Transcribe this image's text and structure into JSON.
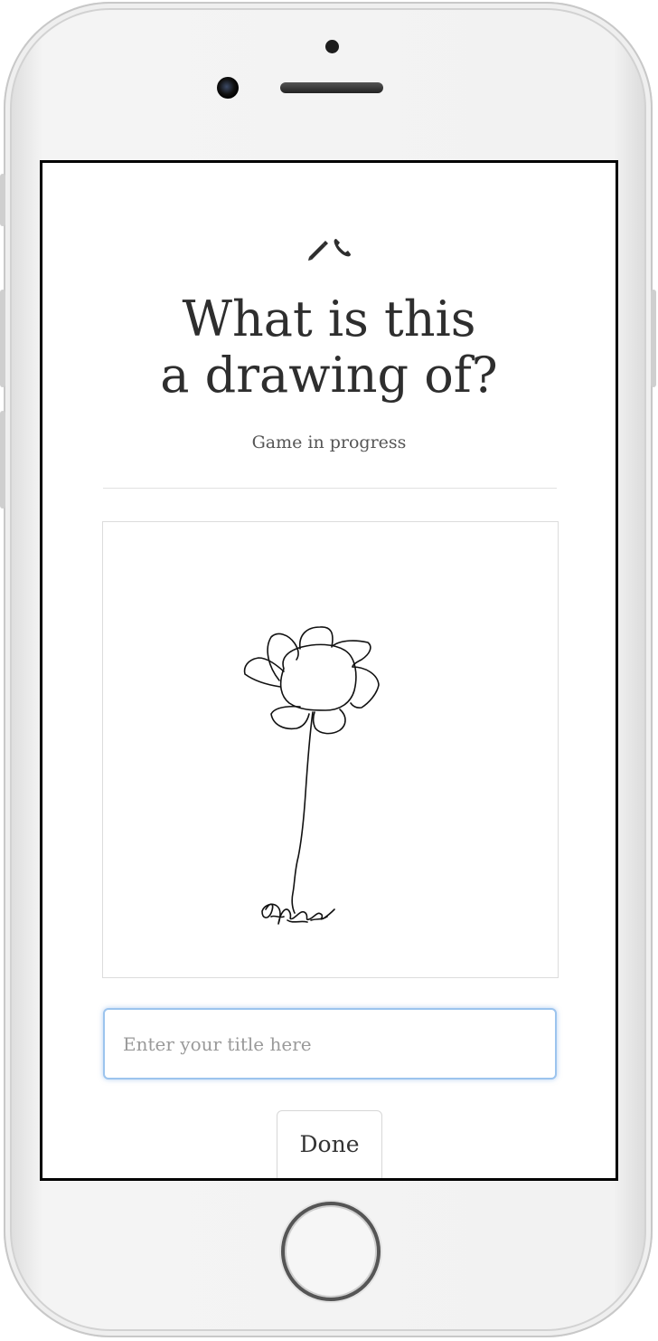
{
  "prompt": {
    "heading": "What is this a drawing of?",
    "status": "Game in progress"
  },
  "guess_input": {
    "value": "",
    "placeholder": "Enter your title here"
  },
  "actions": {
    "done_label": "Done"
  },
  "icons": {
    "app_logo": "pencil-and-phone-icon"
  },
  "drawing": {
    "subject_hint": "sketch of a flower with petals and a stem"
  },
  "colors": {
    "input_focus": "#9cc4ee",
    "text": "#2e2e2e"
  }
}
